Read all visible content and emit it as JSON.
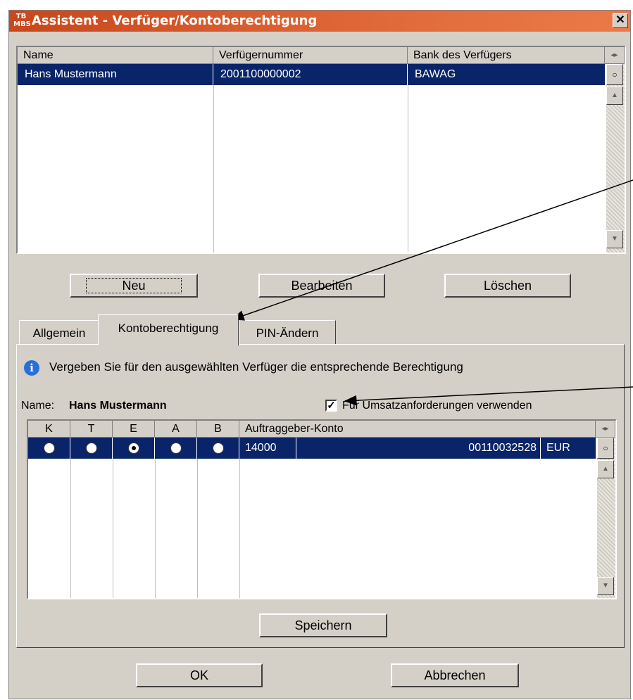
{
  "window": {
    "icon_text": "TB MBS",
    "title": "Assistent - Verfüger/Kontoberechtigung",
    "close_glyph": "✕"
  },
  "users_table": {
    "columns": [
      "Name",
      "Verfügernummer",
      "Bank des Verfügers"
    ],
    "rows": [
      {
        "name": "Hans Mustermann",
        "number": "2001100000002",
        "bank": "BAWAG",
        "selected": true
      }
    ]
  },
  "buttons": {
    "new": "Neu",
    "edit": "Bearbeiten",
    "delete": "Löschen",
    "save": "Speichern",
    "ok": "OK",
    "cancel": "Abbrechen"
  },
  "tabs": [
    {
      "label": "Allgemein",
      "active": false
    },
    {
      "label": "Kontoberechtigung",
      "active": true
    },
    {
      "label": "PIN-Ändern",
      "active": false
    }
  ],
  "panel": {
    "info_text": "Vergeben Sie für den ausgewählten Verfüger die entsprechende Berechtigung",
    "name_label": "Name:",
    "name_value": "Hans Mustermann",
    "checkbox_label": "Für Umsatzanforderungen verwenden",
    "checkbox_checked": true
  },
  "rights_table": {
    "columns": [
      "K",
      "T",
      "E",
      "A",
      "B",
      "Auftraggeber-Konto"
    ],
    "rows": [
      {
        "selected_right": "E",
        "account_id": "14000",
        "account_number": "00110032528",
        "currency": "EUR"
      }
    ]
  },
  "colors": {
    "title_gradient_start": "#c8471c",
    "selection": "#0a246a",
    "face": "#d4d0c8"
  }
}
